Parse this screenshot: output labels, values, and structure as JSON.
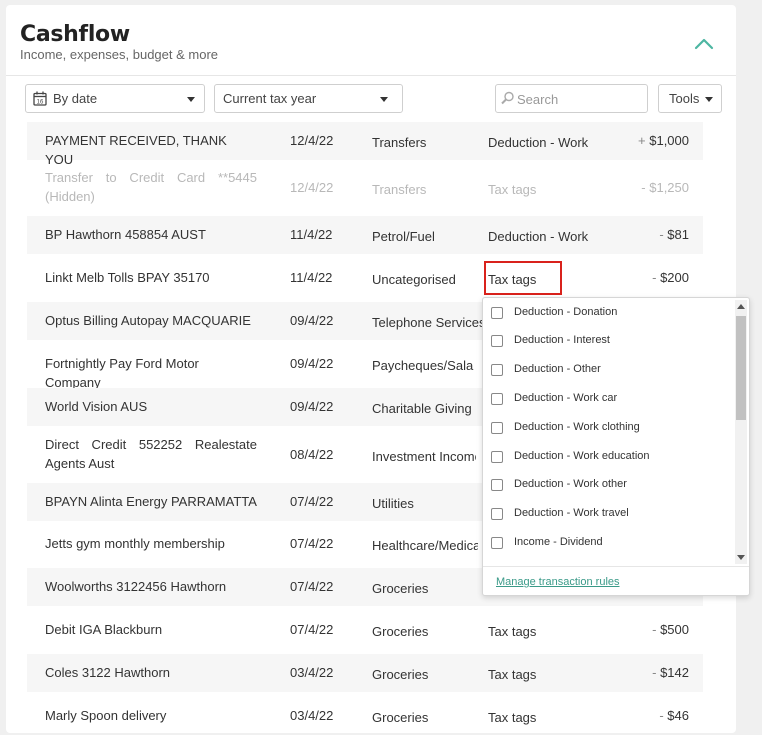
{
  "header": {
    "title": "Cashflow",
    "subtitle": "Income, expenses, budget & more"
  },
  "toolbar": {
    "date_sort": "By date",
    "period": "Current tax year",
    "search_placeholder": "Search",
    "tools_label": "Tools"
  },
  "transactions": [
    {
      "description": "PAYMENT RECEIVED, THANK YOU",
      "date": "12/4/22",
      "category": "Transfers",
      "tag": "Deduction - Work",
      "sign": "+",
      "amount": "$1,000"
    },
    {
      "description": "Transfer to Credit Card **5445 (Hidden)",
      "date": "12/4/22",
      "category": "Transfers",
      "tag": "Tax tags",
      "sign": "-",
      "amount": "$1,250"
    },
    {
      "description": "BP Hawthorn 458854 AUST",
      "date": "11/4/22",
      "category": "Petrol/Fuel",
      "tag": "Deduction - Work",
      "sign": "-",
      "amount": "$81"
    },
    {
      "description": "Linkt Melb Tolls BPAY 35170",
      "date": "11/4/22",
      "category": "Uncategorised",
      "tag": "Tax tags",
      "sign": "-",
      "amount": "$200"
    },
    {
      "description": "Optus Billing Autopay MACQUARIE",
      "date": "09/4/22",
      "category": "Telephone Services"
    },
    {
      "description": "Fortnightly Pay Ford Motor Company",
      "date": "09/4/22",
      "category": "Paycheques/Salary"
    },
    {
      "description": "World Vision AUS",
      "date": "09/4/22",
      "category": "Charitable Giving"
    },
    {
      "description": "Direct Credit 552252 Realestate Agents Aust",
      "date": "08/4/22",
      "category": "Investment Income"
    },
    {
      "description": "BPAYN Alinta Energy PARRAMATTA",
      "date": "07/4/22",
      "category": "Utilities"
    },
    {
      "description": "Jetts gym monthly membership",
      "date": "07/4/22",
      "category": "Healthcare/Medical"
    },
    {
      "description": "Woolworths 3122456 Hawthorn",
      "date": "07/4/22",
      "category": "Groceries"
    },
    {
      "description": "Debit IGA Blackburn",
      "date": "07/4/22",
      "category": "Groceries",
      "tag": "Tax tags",
      "sign": "-",
      "amount": "$500"
    },
    {
      "description": "Coles 3122 Hawthorn",
      "date": "03/4/22",
      "category": "Groceries",
      "tag": "Tax tags",
      "sign": "-",
      "amount": "$142"
    },
    {
      "description": "Marly Spoon delivery",
      "date": "03/4/22",
      "category": "Groceries",
      "tag": "Tax tags",
      "sign": "-",
      "amount": "$46"
    }
  ],
  "tax_tag_menu": {
    "options": [
      "Deduction - Donation",
      "Deduction - Interest",
      "Deduction - Other",
      "Deduction - Work car",
      "Deduction - Work clothing",
      "Deduction - Work education",
      "Deduction - Work other",
      "Deduction - Work travel",
      "Income - Dividend"
    ],
    "manage_link": "Manage transaction rules"
  },
  "colors": {
    "accent": "#3a9a88",
    "highlight": "#d9221c"
  }
}
